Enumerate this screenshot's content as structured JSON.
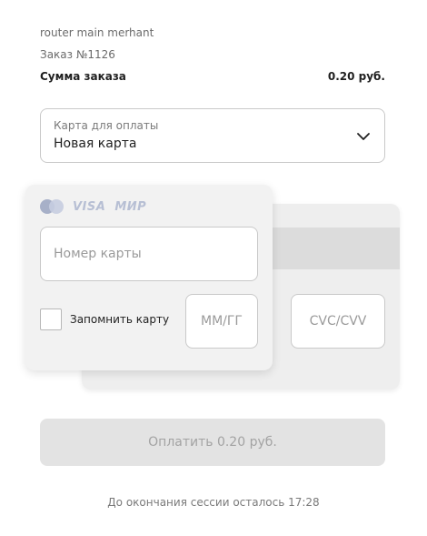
{
  "header": {
    "merchant": "router main merhant",
    "order_number": "Заказ №1126",
    "sum_label": "Сумма заказа",
    "sum_value": "0.20 руб."
  },
  "payment_select": {
    "label": "Карта для оплаты",
    "value": "Новая карта",
    "icon": "chevron-down-icon"
  },
  "card": {
    "brands": [
      "mastercard-icon",
      "VISA",
      "МИР"
    ],
    "number_placeholder": "Номер карты",
    "expiry_placeholder": "ММ/ГГ",
    "cvc_placeholder": "CVC/CVV",
    "remember_label": "Запомнить карту"
  },
  "pay_button": {
    "label": "Оплатить 0.20 руб."
  },
  "session": {
    "text": "До окончания сессии осталось 17:28"
  },
  "colors": {
    "card_front": "#f2f2f2",
    "card_back": "#eeeeee",
    "disabled_button": "#e3e3e3",
    "brand_icons": "#b7bfd4"
  }
}
